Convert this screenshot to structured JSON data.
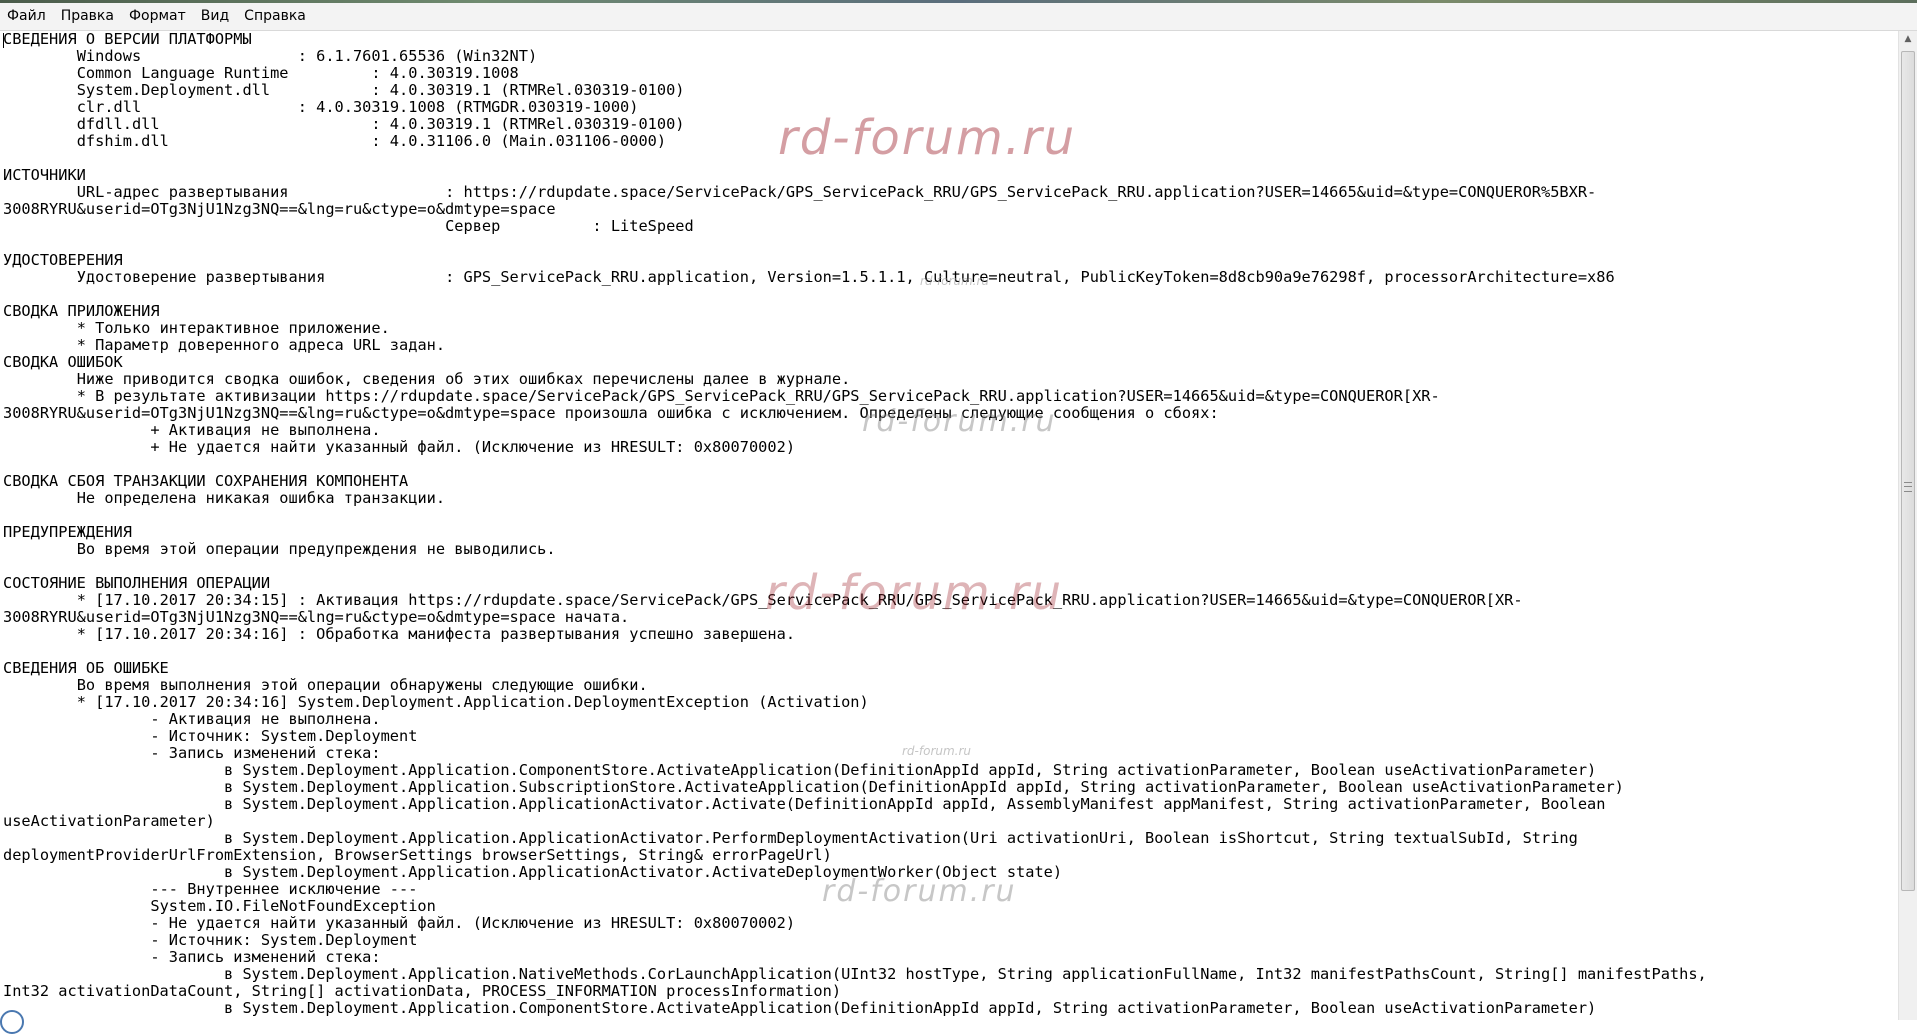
{
  "menu": [
    "Файл",
    "Правка",
    "Формат",
    "Вид",
    "Справка"
  ],
  "lines": [
    "СВЕДЕНИЯ О ВЕРСИИ ПЛАТФОРМЫ",
    "\tWindows\t\t\t: 6.1.7601.65536 (Win32NT)",
    "\tCommon Language Runtime\t\t: 4.0.30319.1008",
    "\tSystem.Deployment.dll\t\t: 4.0.30319.1 (RTMRel.030319-0100)",
    "\tclr.dll\t\t\t: 4.0.30319.1008 (RTMGDR.030319-1000)",
    "\tdfdll.dll\t\t\t: 4.0.30319.1 (RTMRel.030319-0100)",
    "\tdfshim.dll\t\t\t: 4.0.31106.0 (Main.031106-0000)",
    "",
    "ИСТОЧНИКИ",
    "\tURL-адрес развертывания\t\t\t: https://rdupdate.space/ServicePack/GPS_ServicePack_RRU/GPS_ServicePack_RRU.application?USER=14665&uid=&type=CONQUEROR%5BXR-",
    "3008RYRU&userid=OTg3NjU1Nzg3NQ==&lng=ru&ctype=o&dmtype=space",
    "\t\t\t\t\t\tСервер\t\t: LiteSpeed",
    "",
    "УДОСТОВЕРЕНИЯ",
    "\tУдостоверение развертывания\t\t: GPS_ServicePack_RRU.application, Version=1.5.1.1, Culture=neutral, PublicKeyToken=8d8cb90a9e76298f, processorArchitecture=x86",
    "",
    "СВОДКА ПРИЛОЖЕНИЯ",
    "\t* Только интерактивное приложение.",
    "\t* Параметр доверенного адреса URL задан.",
    "СВОДКА ОШИБОК",
    "\tНиже приводится сводка ошибок, сведения об этих ошибках перечислены далее в журнале.",
    "\t* В результате активизации https://rdupdate.space/ServicePack/GPS_ServicePack_RRU/GPS_ServicePack_RRU.application?USER=14665&uid=&type=CONQUEROR[XR-",
    "3008RYRU&userid=OTg3NjU1Nzg3NQ==&lng=ru&ctype=o&dmtype=space произошла ошибка с исключением. Определены следующие сообщения о сбоях:",
    "\t\t+ Активация не выполнена.",
    "\t\t+ Не удается найти указанный файл. (Исключение из HRESULT: 0x80070002)",
    "",
    "СВОДКА СБОЯ ТРАНЗАКЦИИ СОХРАНЕНИЯ КОМПОНЕНТА",
    "\tНе определена никакая ошибка транзакции.",
    "",
    "ПРЕДУПРЕЖДЕНИЯ",
    "\tВо время этой операции предупреждения не выводились.",
    "",
    "СОСТОЯНИЕ ВЫПОЛНЕНИЯ ОПЕРАЦИИ",
    "\t* [17.10.2017 20:34:15] : Активация https://rdupdate.space/ServicePack/GPS_ServicePack_RRU/GPS_ServicePack_RRU.application?USER=14665&uid=&type=CONQUEROR[XR-",
    "3008RYRU&userid=OTg3NjU1Nzg3NQ==&lng=ru&ctype=o&dmtype=space начата.",
    "\t* [17.10.2017 20:34:16] : Обработка манифеста развертывания успешно завершена.",
    "",
    "СВЕДЕНИЯ ОБ ОШИБКЕ",
    "\tВо время выполнения этой операции обнаружены следующие ошибки.",
    "\t* [17.10.2017 20:34:16] System.Deployment.Application.DeploymentException (Activation)",
    "\t\t- Активация не выполнена.",
    "\t\t- Источник: System.Deployment",
    "\t\t- Запись изменений стека:",
    "\t\t\tв System.Deployment.Application.ComponentStore.ActivateApplication(DefinitionAppId appId, String activationParameter, Boolean useActivationParameter)",
    "\t\t\tв System.Deployment.Application.SubscriptionStore.ActivateApplication(DefinitionAppId appId, String activationParameter, Boolean useActivationParameter)",
    "\t\t\tв System.Deployment.Application.ApplicationActivator.Activate(DefinitionAppId appId, AssemblyManifest appManifest, String activationParameter, Boolean",
    "useActivationParameter)",
    "\t\t\tв System.Deployment.Application.ApplicationActivator.PerformDeploymentActivation(Uri activationUri, Boolean isShortcut, String textualSubId, String",
    "deploymentProviderUrlFromExtension, BrowserSettings browserSettings, String& errorPageUrl)",
    "\t\t\tв System.Deployment.Application.ApplicationActivator.ActivateDeploymentWorker(Object state)",
    "\t\t--- Внутреннее исключение ---",
    "\t\tSystem.IO.FileNotFoundException",
    "\t\t- Не удается найти указанный файл. (Исключение из HRESULT: 0x80070002)",
    "\t\t- Источник: System.Deployment",
    "\t\t- Запись изменений стека:",
    "\t\t\tв System.Deployment.Application.NativeMethods.CorLaunchApplication(UInt32 hostType, String applicationFullName, Int32 manifestPathsCount, String[] manifestPaths,",
    "Int32 activationDataCount, String[] activationData, PROCESS_INFORMATION processInformation)",
    "\t\t\tв System.Deployment.Application.ComponentStore.ActivateApplication(DefinitionAppId appId, String activationParameter, Boolean useActivationParameter)"
  ],
  "watermarks": {
    "big": "rd-forum.ru",
    "mid": "rd-forum.ru",
    "small": "rd-forum.ru"
  }
}
